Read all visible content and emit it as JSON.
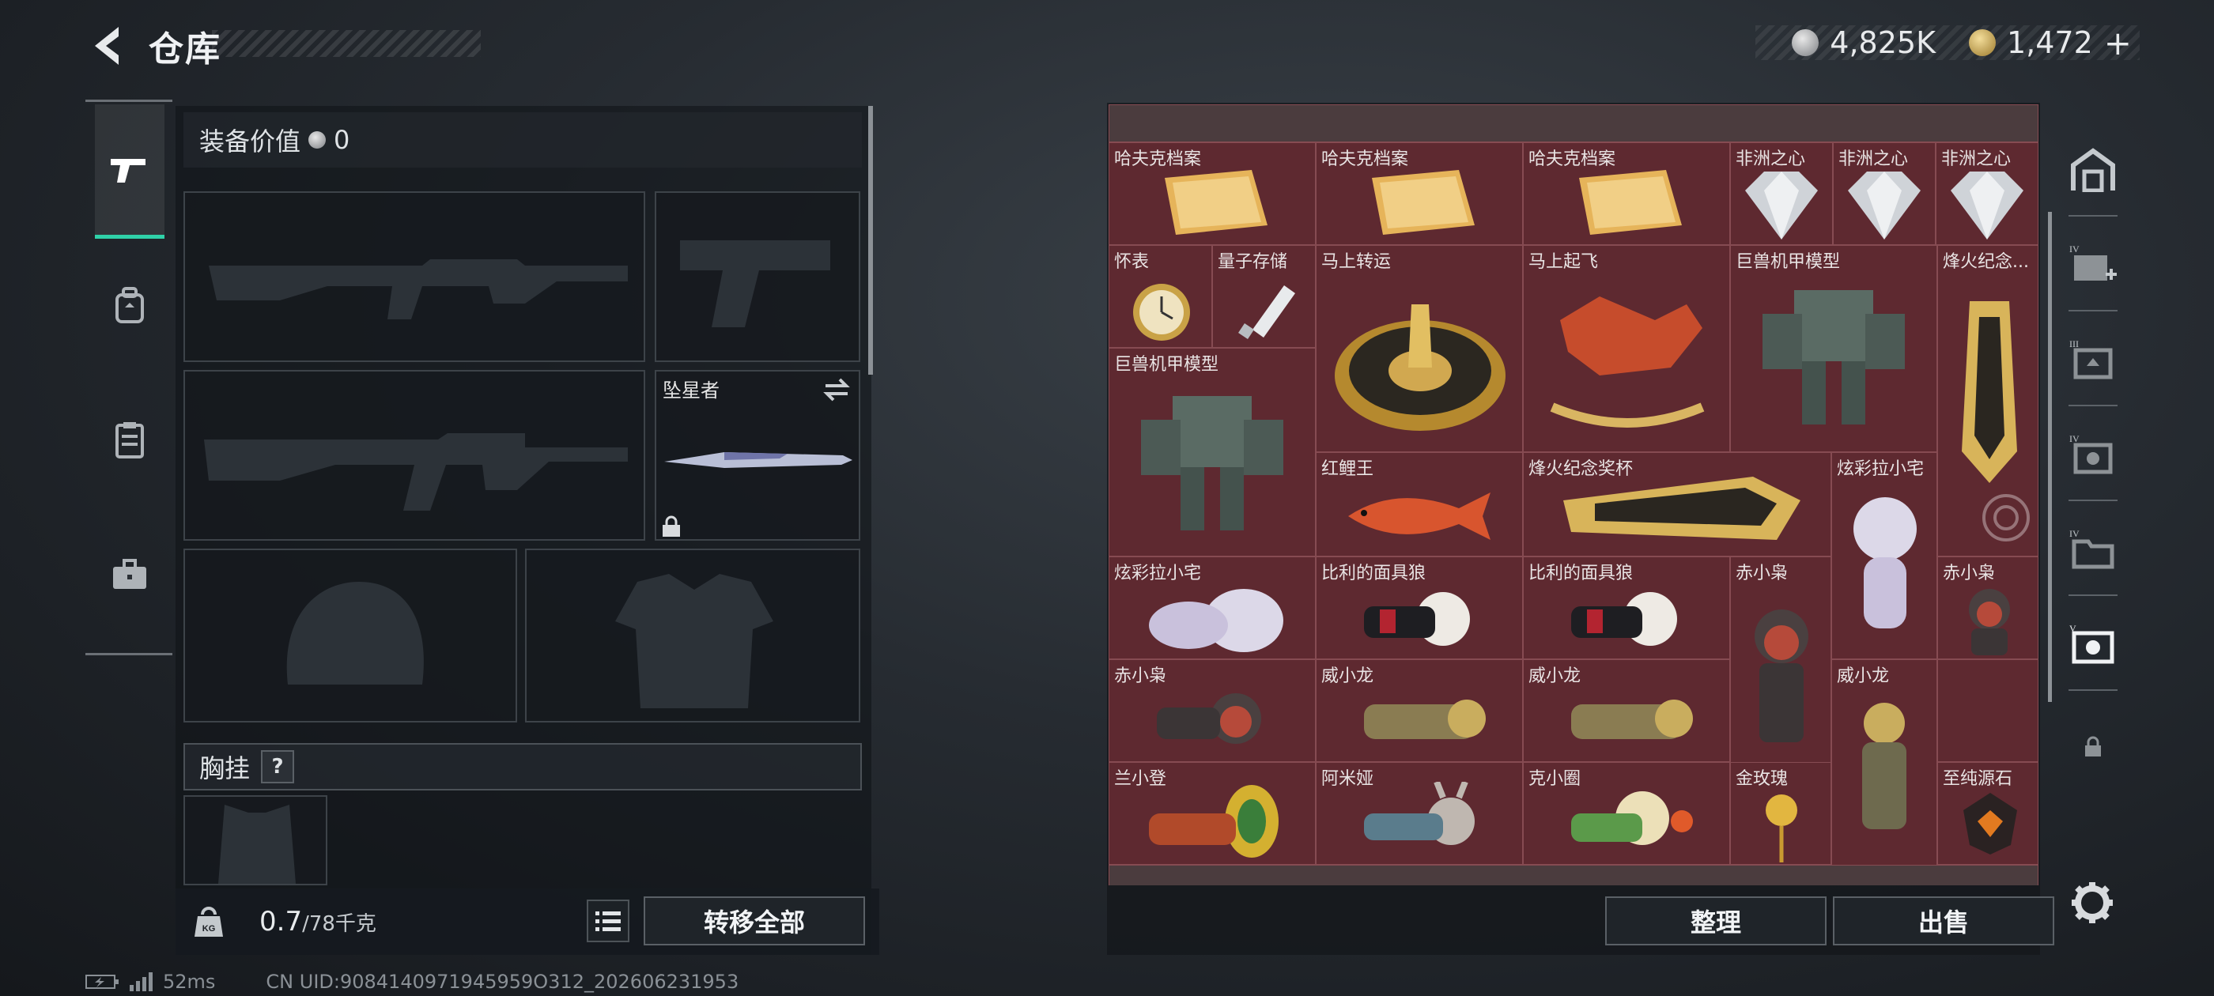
{
  "header": {
    "title": "仓库",
    "currency_silver": "4,825K",
    "currency_gold": "1,472",
    "currency_plus": "+"
  },
  "equipment": {
    "value_label": "装备价值",
    "value": "0",
    "melee_slot_label": "坠星者",
    "chest_rig_label": "胸挂",
    "chest_rig_help": "?"
  },
  "footer": {
    "weight_current": "0.7",
    "weight_max": "/78千克",
    "transfer_all": "转移全部",
    "organize": "整理",
    "sell": "出售",
    "latency": "52ms",
    "uid": "CN UID:9084140971945959O312_202606231953"
  },
  "items": [
    {
      "name": "哈夫克档案"
    },
    {
      "name": "哈夫克档案"
    },
    {
      "name": "哈夫克档案"
    },
    {
      "name": "非洲之心"
    },
    {
      "name": "非洲之心"
    },
    {
      "name": "非洲之心"
    },
    {
      "name": "怀表"
    },
    {
      "name": "量子存储"
    },
    {
      "name": "马上转运"
    },
    {
      "name": "马上起飞"
    },
    {
      "name": "巨兽机甲模型"
    },
    {
      "name": "烽火纪念..."
    },
    {
      "name": "巨兽机甲模型"
    },
    {
      "name": "红鲤王"
    },
    {
      "name": "烽火纪念奖杯"
    },
    {
      "name": "炫彩拉小宅"
    },
    {
      "name": "炫彩拉小宅"
    },
    {
      "name": "比利的面具狼"
    },
    {
      "name": "比利的面具狼"
    },
    {
      "name": "赤小枭"
    },
    {
      "name": "赤小枭"
    },
    {
      "name": "赤小枭"
    },
    {
      "name": "威小龙"
    },
    {
      "name": "威小龙"
    },
    {
      "name": "威小龙"
    },
    {
      "name": "兰小登"
    },
    {
      "name": "阿米娅"
    },
    {
      "name": "克小圈"
    },
    {
      "name": "金玫瑰"
    },
    {
      "name": "至纯源石"
    }
  ],
  "colors": {
    "accent": "#2fd1a8",
    "cell_bg": "#5e2930",
    "panel_bg": "#16191d"
  }
}
